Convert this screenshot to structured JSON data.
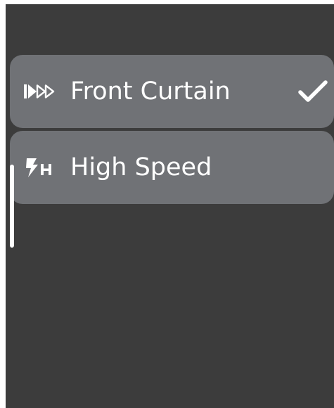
{
  "menu": {
    "items": [
      {
        "label": "Front Curtain",
        "icon": "front-curtain-sync-icon",
        "selected": true
      },
      {
        "label": "High Speed",
        "icon": "high-speed-flash-icon",
        "selected": false
      }
    ]
  },
  "colors": {
    "background": "#3c3c3c",
    "item_background": "#707276",
    "text": "#ffffff"
  },
  "icons": {
    "selected": "checkmark-icon"
  }
}
